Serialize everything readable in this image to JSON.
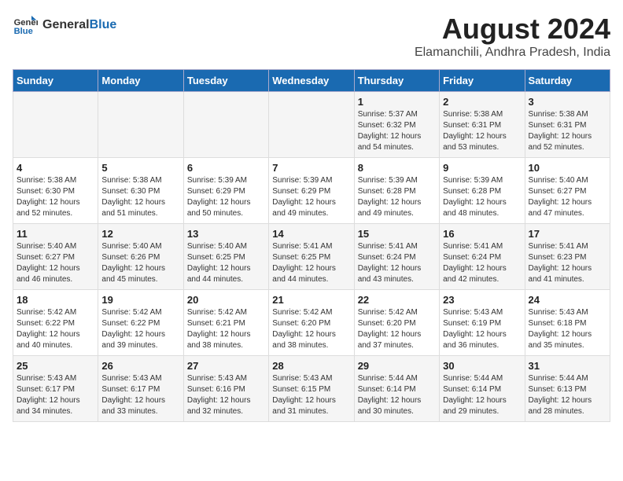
{
  "logo": {
    "general": "General",
    "blue": "Blue"
  },
  "title": "August 2024",
  "subtitle": "Elamanchili, Andhra Pradesh, India",
  "days_of_week": [
    "Sunday",
    "Monday",
    "Tuesday",
    "Wednesday",
    "Thursday",
    "Friday",
    "Saturday"
  ],
  "weeks": [
    [
      {
        "day": "",
        "info": ""
      },
      {
        "day": "",
        "info": ""
      },
      {
        "day": "",
        "info": ""
      },
      {
        "day": "",
        "info": ""
      },
      {
        "day": "1",
        "info": "Sunrise: 5:37 AM\nSunset: 6:32 PM\nDaylight: 12 hours\nand 54 minutes."
      },
      {
        "day": "2",
        "info": "Sunrise: 5:38 AM\nSunset: 6:31 PM\nDaylight: 12 hours\nand 53 minutes."
      },
      {
        "day": "3",
        "info": "Sunrise: 5:38 AM\nSunset: 6:31 PM\nDaylight: 12 hours\nand 52 minutes."
      }
    ],
    [
      {
        "day": "4",
        "info": "Sunrise: 5:38 AM\nSunset: 6:30 PM\nDaylight: 12 hours\nand 52 minutes."
      },
      {
        "day": "5",
        "info": "Sunrise: 5:38 AM\nSunset: 6:30 PM\nDaylight: 12 hours\nand 51 minutes."
      },
      {
        "day": "6",
        "info": "Sunrise: 5:39 AM\nSunset: 6:29 PM\nDaylight: 12 hours\nand 50 minutes."
      },
      {
        "day": "7",
        "info": "Sunrise: 5:39 AM\nSunset: 6:29 PM\nDaylight: 12 hours\nand 49 minutes."
      },
      {
        "day": "8",
        "info": "Sunrise: 5:39 AM\nSunset: 6:28 PM\nDaylight: 12 hours\nand 49 minutes."
      },
      {
        "day": "9",
        "info": "Sunrise: 5:39 AM\nSunset: 6:28 PM\nDaylight: 12 hours\nand 48 minutes."
      },
      {
        "day": "10",
        "info": "Sunrise: 5:40 AM\nSunset: 6:27 PM\nDaylight: 12 hours\nand 47 minutes."
      }
    ],
    [
      {
        "day": "11",
        "info": "Sunrise: 5:40 AM\nSunset: 6:27 PM\nDaylight: 12 hours\nand 46 minutes."
      },
      {
        "day": "12",
        "info": "Sunrise: 5:40 AM\nSunset: 6:26 PM\nDaylight: 12 hours\nand 45 minutes."
      },
      {
        "day": "13",
        "info": "Sunrise: 5:40 AM\nSunset: 6:25 PM\nDaylight: 12 hours\nand 44 minutes."
      },
      {
        "day": "14",
        "info": "Sunrise: 5:41 AM\nSunset: 6:25 PM\nDaylight: 12 hours\nand 44 minutes."
      },
      {
        "day": "15",
        "info": "Sunrise: 5:41 AM\nSunset: 6:24 PM\nDaylight: 12 hours\nand 43 minutes."
      },
      {
        "day": "16",
        "info": "Sunrise: 5:41 AM\nSunset: 6:24 PM\nDaylight: 12 hours\nand 42 minutes."
      },
      {
        "day": "17",
        "info": "Sunrise: 5:41 AM\nSunset: 6:23 PM\nDaylight: 12 hours\nand 41 minutes."
      }
    ],
    [
      {
        "day": "18",
        "info": "Sunrise: 5:42 AM\nSunset: 6:22 PM\nDaylight: 12 hours\nand 40 minutes."
      },
      {
        "day": "19",
        "info": "Sunrise: 5:42 AM\nSunset: 6:22 PM\nDaylight: 12 hours\nand 39 minutes."
      },
      {
        "day": "20",
        "info": "Sunrise: 5:42 AM\nSunset: 6:21 PM\nDaylight: 12 hours\nand 38 minutes."
      },
      {
        "day": "21",
        "info": "Sunrise: 5:42 AM\nSunset: 6:20 PM\nDaylight: 12 hours\nand 38 minutes."
      },
      {
        "day": "22",
        "info": "Sunrise: 5:42 AM\nSunset: 6:20 PM\nDaylight: 12 hours\nand 37 minutes."
      },
      {
        "day": "23",
        "info": "Sunrise: 5:43 AM\nSunset: 6:19 PM\nDaylight: 12 hours\nand 36 minutes."
      },
      {
        "day": "24",
        "info": "Sunrise: 5:43 AM\nSunset: 6:18 PM\nDaylight: 12 hours\nand 35 minutes."
      }
    ],
    [
      {
        "day": "25",
        "info": "Sunrise: 5:43 AM\nSunset: 6:17 PM\nDaylight: 12 hours\nand 34 minutes."
      },
      {
        "day": "26",
        "info": "Sunrise: 5:43 AM\nSunset: 6:17 PM\nDaylight: 12 hours\nand 33 minutes."
      },
      {
        "day": "27",
        "info": "Sunrise: 5:43 AM\nSunset: 6:16 PM\nDaylight: 12 hours\nand 32 minutes."
      },
      {
        "day": "28",
        "info": "Sunrise: 5:43 AM\nSunset: 6:15 PM\nDaylight: 12 hours\nand 31 minutes."
      },
      {
        "day": "29",
        "info": "Sunrise: 5:44 AM\nSunset: 6:14 PM\nDaylight: 12 hours\nand 30 minutes."
      },
      {
        "day": "30",
        "info": "Sunrise: 5:44 AM\nSunset: 6:14 PM\nDaylight: 12 hours\nand 29 minutes."
      },
      {
        "day": "31",
        "info": "Sunrise: 5:44 AM\nSunset: 6:13 PM\nDaylight: 12 hours\nand 28 minutes."
      }
    ]
  ]
}
